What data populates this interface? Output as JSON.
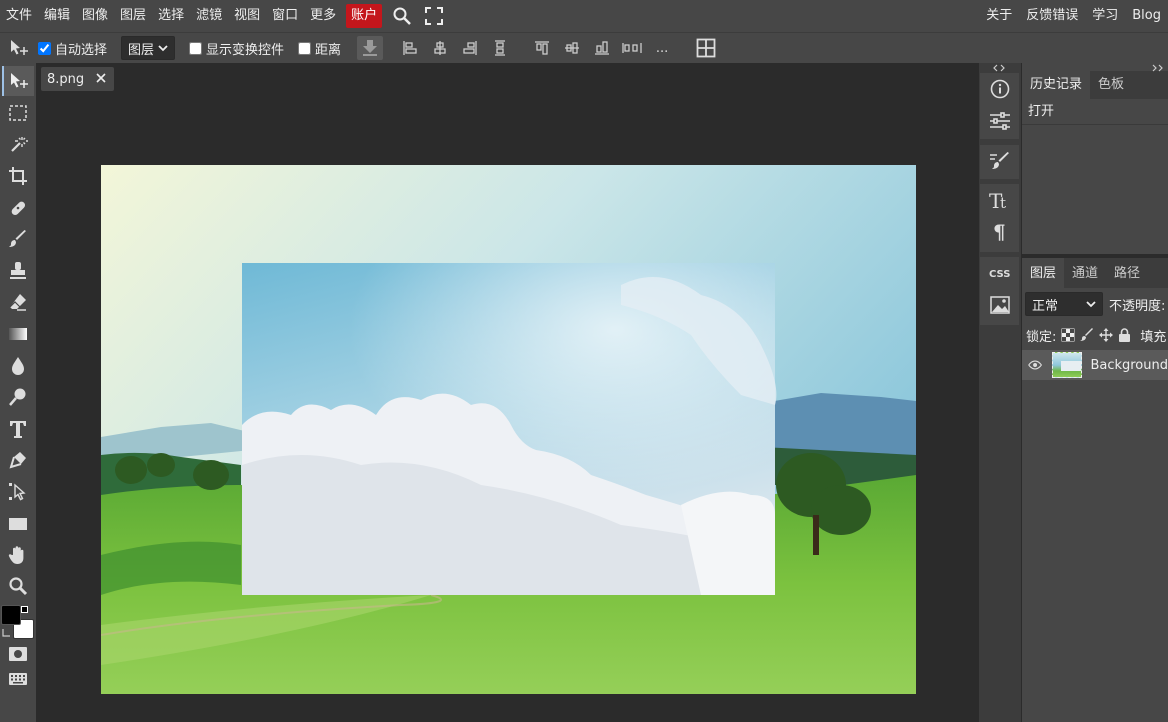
{
  "menubar": {
    "items": [
      "文件",
      "编辑",
      "图像",
      "图层",
      "选择",
      "滤镜",
      "视图",
      "窗口",
      "更多"
    ],
    "account": "账户",
    "right_items": [
      "关于",
      "反馈错误",
      "学习",
      "Blog"
    ],
    "icons": [
      "search-icon",
      "fullscreen-icon"
    ]
  },
  "options": {
    "auto_select_label": "自动选择",
    "auto_select_checked": true,
    "layer_select_value": "图层",
    "show_transform_label": "显示变换控件",
    "distance_label": "距离",
    "more_label": "..."
  },
  "document": {
    "tab_name": "8.png"
  },
  "history_panel": {
    "tabs": [
      "历史记录",
      "色板"
    ],
    "items": [
      "打开"
    ]
  },
  "layers_panel": {
    "tabs": [
      "图层",
      "通道",
      "路径"
    ],
    "blend_mode": "正常",
    "opacity_label": "不透明度:",
    "lock_label": "锁定:",
    "fill_label": "填充",
    "layers": [
      {
        "name": "Background"
      }
    ]
  },
  "colors": {
    "accent_account": "#c4161c",
    "foreground": "#000000",
    "background": "#ffffff"
  }
}
